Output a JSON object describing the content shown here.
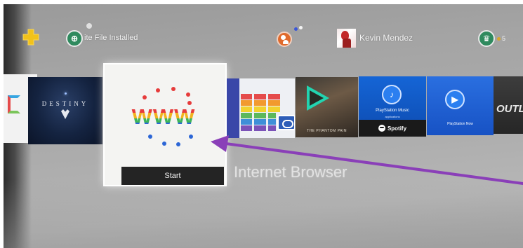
{
  "topbar": {
    "notification_text": "ite File  Installed",
    "username": "Kevin Mendez",
    "trophy_level": "5"
  },
  "content": {
    "tiles": [
      {
        "id": "prev",
        "icon": "tv-icon"
      },
      {
        "id": "destiny",
        "title": "DESTINY"
      },
      {
        "id": "browser",
        "logo_text": "WWW",
        "action_label": "Start",
        "name": "Internet Browser"
      },
      {
        "id": "flag-app",
        "icon": "rainbow-flag-icon"
      },
      {
        "id": "mgs",
        "caption": "THE PHANTOM PAIN"
      },
      {
        "id": "music",
        "label": "PlayStation Music",
        "sublabel": "applications",
        "partner": "Spotify"
      },
      {
        "id": "psnow",
        "label": "PlayStation Now"
      },
      {
        "id": "outlast",
        "label": "OUTLA"
      }
    ]
  },
  "colors": {
    "www_red": "#e63b3b",
    "www_blue": "#2c66d6",
    "arrow": "#8a3fb8",
    "ps_blue": "#1565d6",
    "trophy_green": "#2f8a5e"
  }
}
